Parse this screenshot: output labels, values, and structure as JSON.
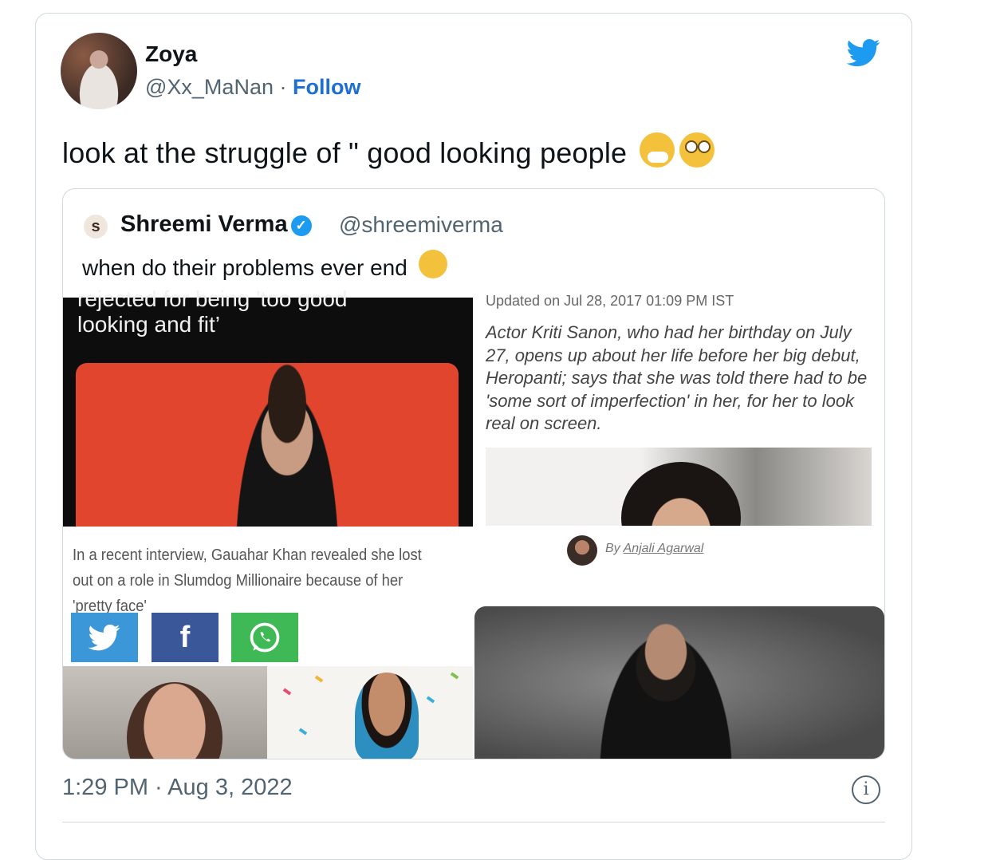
{
  "tweet": {
    "author_name": "Zoya",
    "author_handle": "@Xx_MaNan",
    "separator": " · ",
    "follow_label": "Follow",
    "text": "look at the struggle of \" good looking people",
    "emoji": [
      "sneezing-face",
      "face-with-rolling-eyes"
    ],
    "timestamp": "1:29 PM · Aug 3, 2022",
    "info_symbol": "i"
  },
  "quoted_tweet": {
    "avatar_glyph": "s",
    "author_name": "Shreemi Verma",
    "author_handle": "@shreemiverma",
    "verified": true,
    "text": "when do their problems ever end",
    "emoji": [
      "loudly-crying-face"
    ]
  },
  "collage": {
    "left_headline_cut": "rejected for being 'too good",
    "left_headline": "looking and fit’",
    "left_caption": "In a recent interview, Gauahar Khan revealed she lost out on a role in Slumdog Millionaire because of her 'pretty face'",
    "share_buttons": [
      "twitter",
      "facebook",
      "whatsapp"
    ],
    "updated": "Updated on Jul 28, 2017 01:09 PM IST",
    "summary": "Actor Kriti Sanon, who had her birthday on July 27, opens up about her life before her big debut, Heropanti; says that she was told there had to be 'some sort of imperfection' in her, for her to look real on screen.",
    "byline_prefix": "By ",
    "byline_author": "Anjali Agarwal"
  },
  "colors": {
    "twitter_blue": "#1d9bf0",
    "follow_blue": "#1d6fd1",
    "secondary_text": "#536471",
    "border": "#cfd9de"
  }
}
